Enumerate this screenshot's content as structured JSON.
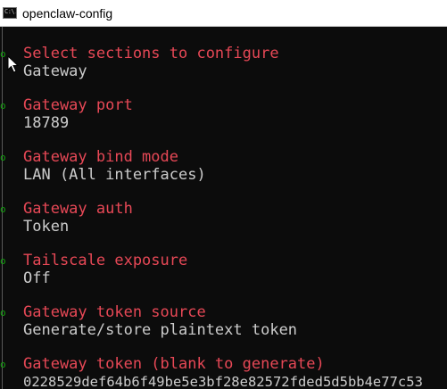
{
  "window": {
    "title": "openclaw-config",
    "icon_label": "C:\\."
  },
  "sections": [
    {
      "title": "Select sections to configure",
      "value": "Gateway",
      "marker": "o"
    },
    {
      "title": "Gateway port",
      "value": "18789",
      "marker": "o"
    },
    {
      "title": "Gateway bind mode",
      "value": "LAN (All interfaces)",
      "marker": "o"
    },
    {
      "title": "Gateway auth",
      "value": "Token",
      "marker": "o"
    },
    {
      "title": "Tailscale exposure",
      "value": "Off",
      "marker": "o"
    },
    {
      "title": "Gateway token source",
      "value": "Generate/store plaintext token",
      "marker": "o"
    },
    {
      "title": "Gateway token (blank to generate)",
      "value": "0228529def64b6f49be5e3bf28e82572fded5d5bb4e77c53",
      "marker": "o"
    }
  ],
  "colors": {
    "background": "#0c0c0c",
    "heading": "#e74856",
    "value": "#cccccc",
    "marker": "#13a10e",
    "gutter": "#5a5a5a"
  },
  "icons": {
    "app": "console-icon",
    "pointer": "mouse-pointer-icon"
  }
}
